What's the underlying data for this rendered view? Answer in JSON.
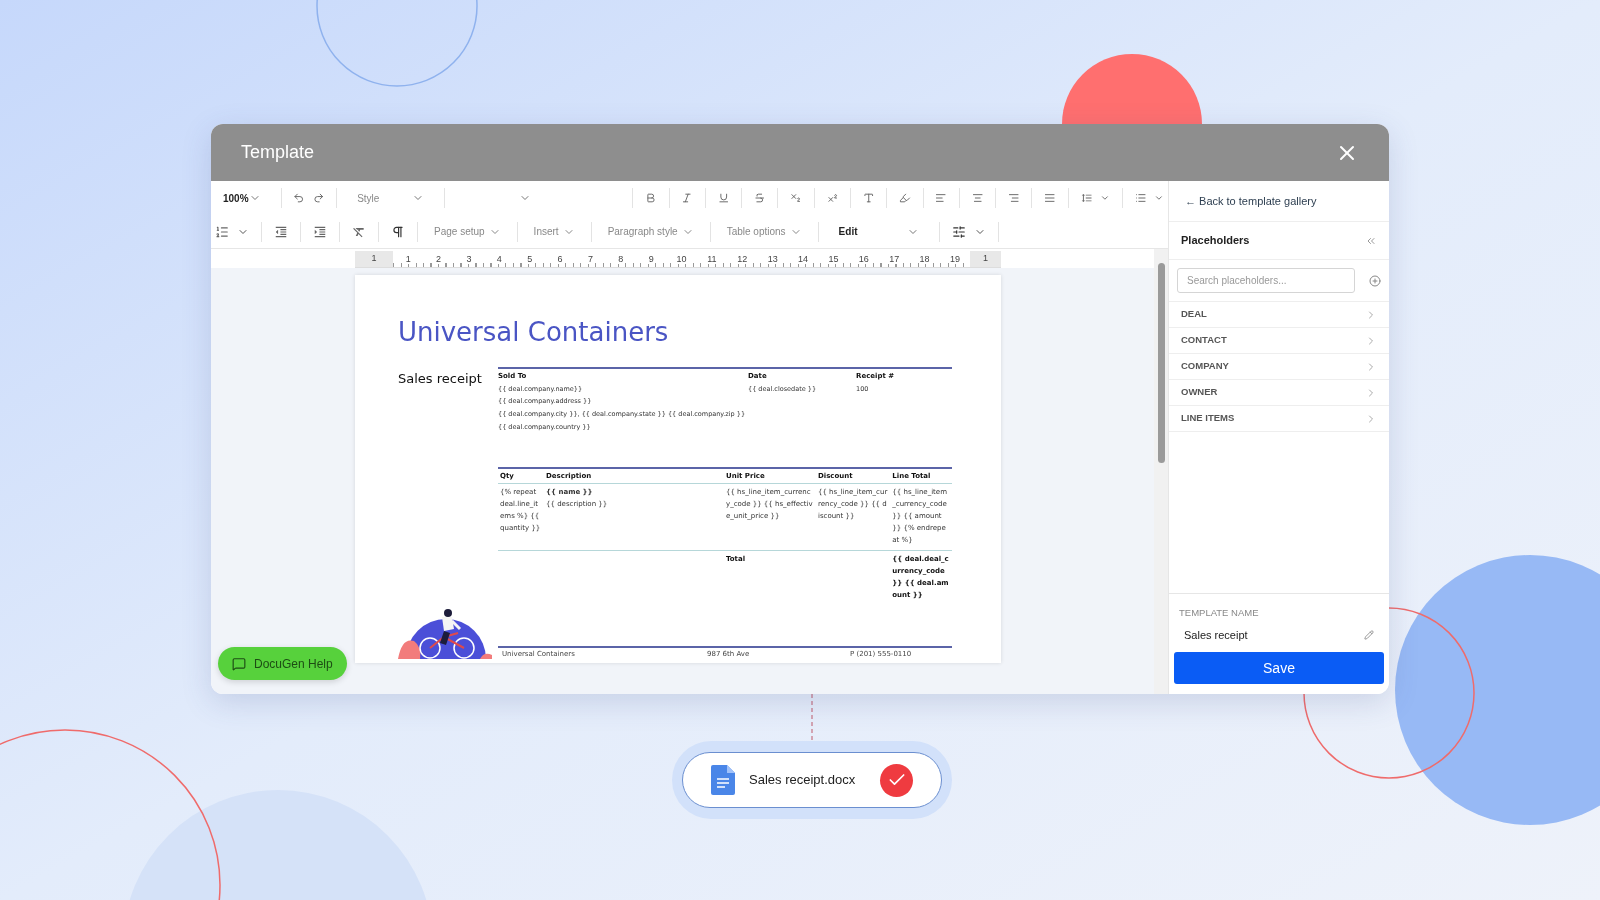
{
  "window": {
    "title": "Template"
  },
  "toolbar": {
    "zoom": "100%",
    "style": "Style",
    "menus": [
      "Page setup",
      "Insert",
      "Paragraph style",
      "Table options"
    ],
    "mode": "Edit"
  },
  "ruler": {
    "labels": [
      "1",
      "1",
      "2",
      "3",
      "4",
      "5",
      "6",
      "7",
      "8",
      "9",
      "10",
      "11",
      "12",
      "13",
      "14",
      "15",
      "16",
      "17",
      "18",
      "19",
      "1"
    ]
  },
  "document": {
    "title": "Universal Containers",
    "subtitle": "Sales receipt",
    "info_table": {
      "columns": [
        "Sold To",
        "Date",
        "Receipt #"
      ],
      "cells": [
        [
          "{{ deal.company.name}}",
          "{{ deal.company.address }}",
          "{{ deal.company.city }}, {{ deal.company.state }} {{ deal.company.zip }}",
          "{{ deal.company.country }}"
        ],
        [
          "{{ deal.closedate }}"
        ],
        [
          "100"
        ]
      ]
    },
    "items_table": {
      "columns": [
        "Qty",
        "Description",
        "Unit Price",
        "Discount",
        "Line Total"
      ],
      "row": [
        [
          "{% repeat deal.line_items %} {{ quantity }}"
        ],
        [
          "{{ name }}",
          "{{ description }}"
        ],
        [
          "{{ hs_line_item_currency_code }} {{ hs_effective_unit_price }}"
        ],
        [
          "{{ hs_line_item_currency_code }} {{ discount }}"
        ],
        [
          "{{ hs_line_item_currency_code }} {{ amount }} {% endrepeat %}"
        ]
      ],
      "total_label": "Total",
      "total_value": "{{ deal.deal_currency_code }} {{ deal.amount }}"
    },
    "footer": [
      "Universal Containers",
      "987 6th Ave",
      "P (201) 555-0110"
    ]
  },
  "help_button": "DocuGen Help",
  "sidebar": {
    "back_link": "← Back to template gallery",
    "title": "Placeholders",
    "search": {
      "placeholder": "Search placeholders..."
    },
    "categories": [
      "DEAL",
      "CONTACT",
      "COMPANY",
      "OWNER",
      "LINE ITEMS"
    ],
    "template_name_label": "TEMPLATE NAME",
    "template_name": "Sales receipt",
    "save": "Save"
  },
  "file_chip": {
    "name": "Sales receipt.docx",
    "done": true
  }
}
